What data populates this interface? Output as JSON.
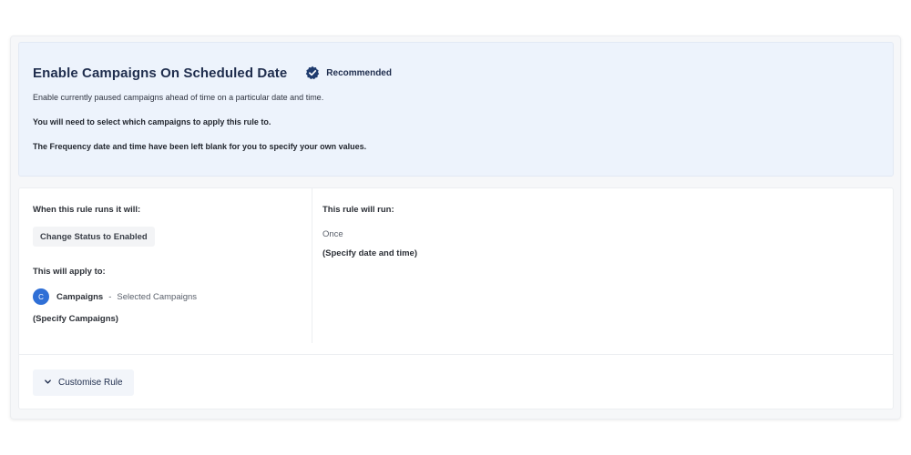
{
  "header": {
    "title": "Enable Campaigns On Scheduled Date",
    "badge_icon": "verified-check-icon",
    "badge_label": "Recommended",
    "description": "Enable currently paused campaigns ahead of time on a particular date and time.",
    "note_campaigns": "You will need to select which campaigns to apply this rule to.",
    "note_frequency": "The Frequency date and time have been left blank for you to specify your own values."
  },
  "actions": {
    "heading": "When this rule runs it will:",
    "action_chip": "Change Status to Enabled",
    "apply_heading": "This will apply to:",
    "apply_avatar": "C",
    "apply_name": "Campaigns",
    "apply_separator": "-",
    "apply_value": "Selected Campaigns",
    "apply_note": "(Specify Campaigns)"
  },
  "schedule": {
    "heading": "This rule will run:",
    "frequency": "Once",
    "note": "(Specify date and time)"
  },
  "footer": {
    "customise_label": "Customise Rule",
    "customise_icon": "chevron-down-icon"
  },
  "colors": {
    "accent": "#2f6fd6",
    "header_bg": "#edf3fc",
    "title": "#1f2d4d"
  }
}
